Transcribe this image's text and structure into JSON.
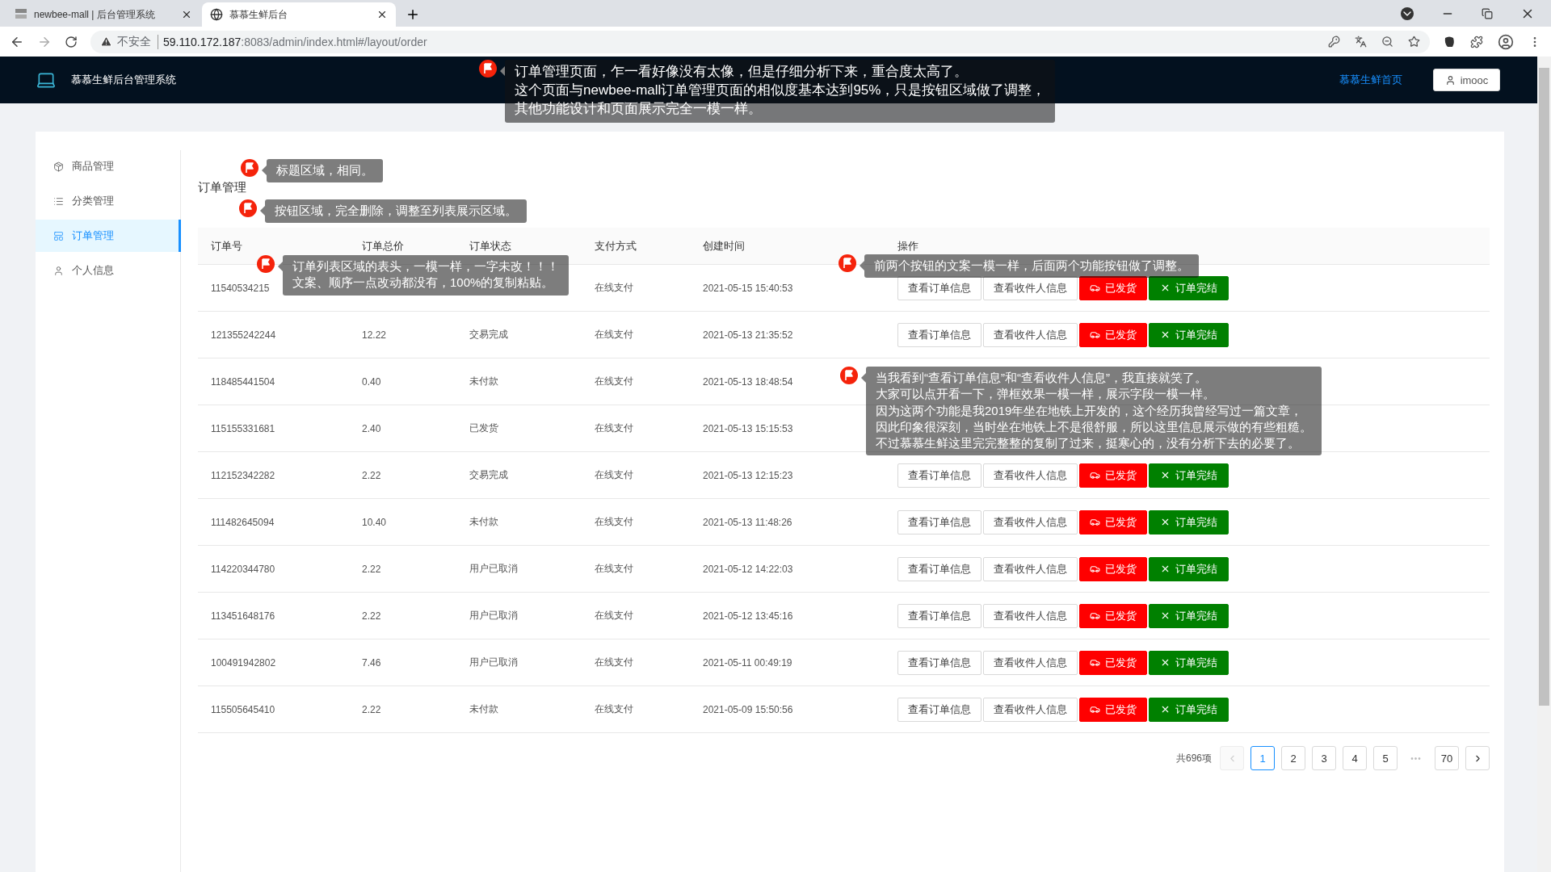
{
  "browser": {
    "tabs": [
      {
        "title": "newbee-mall | 后台管理系统",
        "selected": false
      },
      {
        "title": "慕慕生鲜后台",
        "selected": true
      }
    ],
    "address": {
      "security": "不安全",
      "host": "59.110.172.187",
      "path": ":8083/admin/index.html#/layout/order"
    }
  },
  "header": {
    "title": "慕慕生鲜后台管理系统",
    "home_link": "慕慕生鲜首页",
    "user": "imooc"
  },
  "sidebar": {
    "items": [
      {
        "label": "商品管理",
        "kind": "goods",
        "selected": false
      },
      {
        "label": "分类管理",
        "kind": "category",
        "selected": false
      },
      {
        "label": "订单管理",
        "kind": "order",
        "selected": true
      },
      {
        "label": "个人信息",
        "kind": "profile",
        "selected": false
      }
    ]
  },
  "page": {
    "title": "订单管理"
  },
  "table": {
    "columns": [
      "订单号",
      "订单总价",
      "订单状态",
      "支付方式",
      "创建时间",
      "操作"
    ],
    "rows": [
      {
        "order_no": "11540534215",
        "payment": "在线支付",
        "created": "2021-05-15 15:40:53",
        "actions": [
          {
            "label": "查看订单信息",
            "kind": "default"
          },
          {
            "label": "查看收件人信息",
            "kind": "default"
          },
          {
            "label": "已发货",
            "kind": "danger"
          },
          {
            "label": "订单完结",
            "kind": "success"
          }
        ]
      },
      {
        "order_no": "121355242244",
        "total": "12.22",
        "status": "交易完成",
        "payment": "在线支付",
        "created": "2021-05-13 21:35:52",
        "actions": [
          {
            "label": "查看订单信息",
            "kind": "default"
          },
          {
            "label": "查看收件人信息",
            "kind": "default"
          },
          {
            "label": "已发货",
            "kind": "danger"
          },
          {
            "label": "订单完结",
            "kind": "success"
          }
        ]
      },
      {
        "order_no": "118485441504",
        "total": "0.40",
        "status": "未付款",
        "payment": "在线支付",
        "created": "2021-05-13 18:48:54"
      },
      {
        "order_no": "115155331681",
        "total": "2.40",
        "status": "已发货",
        "payment": "在线支付",
        "created": "2021-05-13 15:15:53"
      },
      {
        "order_no": "112152342282",
        "total": "2.22",
        "status": "交易完成",
        "payment": "在线支付",
        "created": "2021-05-13 12:15:23",
        "actions": [
          {
            "label": "查看订单信息",
            "kind": "default"
          },
          {
            "label": "查看收件人信息",
            "kind": "default"
          },
          {
            "label": "已发货",
            "kind": "danger"
          },
          {
            "label": "订单完结",
            "kind": "success"
          }
        ]
      },
      {
        "order_no": "111482645094",
        "total": "10.40",
        "status": "未付款",
        "payment": "在线支付",
        "created": "2021-05-13 11:48:26",
        "actions": [
          {
            "label": "查看订单信息",
            "kind": "default"
          },
          {
            "label": "查看收件人信息",
            "kind": "default"
          },
          {
            "label": "已发货",
            "kind": "danger"
          },
          {
            "label": "订单完结",
            "kind": "success"
          }
        ]
      },
      {
        "order_no": "114220344780",
        "total": "2.22",
        "status": "用户已取消",
        "payment": "在线支付",
        "created": "2021-05-12 14:22:03",
        "actions": [
          {
            "label": "查看订单信息",
            "kind": "default"
          },
          {
            "label": "查看收件人信息",
            "kind": "default"
          },
          {
            "label": "已发货",
            "kind": "danger"
          },
          {
            "label": "订单完结",
            "kind": "success"
          }
        ]
      },
      {
        "order_no": "113451648176",
        "total": "2.22",
        "status": "用户已取消",
        "payment": "在线支付",
        "created": "2021-05-12 13:45:16",
        "actions": [
          {
            "label": "查看订单信息",
            "kind": "default"
          },
          {
            "label": "查看收件人信息",
            "kind": "default"
          },
          {
            "label": "已发货",
            "kind": "danger"
          },
          {
            "label": "订单完结",
            "kind": "success"
          }
        ]
      },
      {
        "order_no": "100491942802",
        "total": "7.46",
        "status": "用户已取消",
        "payment": "在线支付",
        "created": "2021-05-11 00:49:19",
        "actions": [
          {
            "label": "查看订单信息",
            "kind": "default"
          },
          {
            "label": "查看收件人信息",
            "kind": "default"
          },
          {
            "label": "已发货",
            "kind": "danger"
          },
          {
            "label": "订单完结",
            "kind": "success"
          }
        ]
      },
      {
        "order_no": "115505645410",
        "total": "2.22",
        "status": "未付款",
        "payment": "在线支付",
        "created": "2021-05-09 15:50:56",
        "actions": [
          {
            "label": "查看订单信息",
            "kind": "default"
          },
          {
            "label": "查看收件人信息",
            "kind": "default"
          },
          {
            "label": "已发货",
            "kind": "danger"
          },
          {
            "label": "订单完结",
            "kind": "success"
          }
        ]
      }
    ]
  },
  "pagination": {
    "total": "共696项",
    "items": [
      {
        "kind": "prev",
        "disabled": true
      },
      {
        "kind": "page",
        "label": "1",
        "selected": true
      },
      {
        "kind": "page",
        "label": "2",
        "selected": false
      },
      {
        "kind": "page",
        "label": "3",
        "selected": false
      },
      {
        "kind": "page",
        "label": "4",
        "selected": false
      },
      {
        "kind": "page",
        "label": "5",
        "selected": false
      },
      {
        "kind": "ellipsis",
        "label": "•••"
      },
      {
        "kind": "page",
        "label": "70",
        "selected": false
      },
      {
        "kind": "next",
        "disabled": false
      }
    ]
  },
  "annotations": [
    {
      "lines": [
        "订单管理页面，乍一看好像没有太像，但是仔细分析下来，重合度太高了。",
        "这个页面与newbee-mall订单管理页面的相似度基本达到95%，只是按钮区域做了调整，",
        "其他功能设计和页面展示完全一模一样。"
      ]
    },
    {
      "lines": [
        "标题区域，相同。"
      ]
    },
    {
      "lines": [
        "按钮区域，完全删除，调整至列表展示区域。"
      ]
    },
    {
      "lines": [
        "订单列表区域的表头，一模一样，一字未改！！！",
        "文案、顺序一点改动都没有，100%的复制粘贴。"
      ]
    },
    {
      "lines": [
        "前两个按钮的文案一模一样，后面两个功能按钮做了调整。"
      ]
    },
    {
      "lines": [
        "当我看到“查看订单信息”和“查看收件人信息”，我直接就笑了。",
        "大家可以点开看一下，弹框效果一模一样，展示字段一模一样。",
        "因为这两个功能是我2019年坐在地铁上开发的，这个经历我曾经写过一篇文章，",
        "因此印象很深刻，当时坐在地铁上不是很舒服，所以这里信息展示做的有些粗糙。",
        "不过慕慕生鲜这里完完整整的复制了过来，挺寒心的，没有分析下去的必要了。"
      ]
    }
  ]
}
